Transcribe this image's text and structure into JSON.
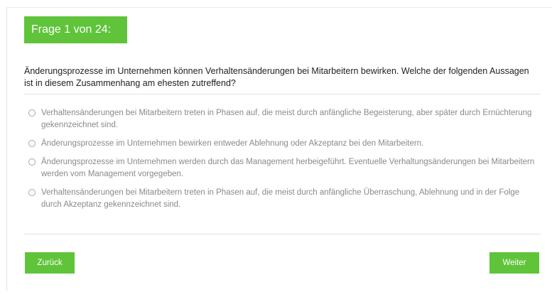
{
  "header": {
    "title": "Frage 1 von 24:"
  },
  "question": {
    "text": "Änderungsprozesse im Unternehmen können Verhaltensänderungen bei Mitarbeitern bewirken. Welche der folgenden Aussagen ist in diesem Zusammenhang am ehesten zutreffend?"
  },
  "options": [
    {
      "label": "Verhaltensänderungen bei Mitarbeitern treten in Phasen auf, die meist durch anfängliche Begeisterung, aber später durch Ernüchterung gekennzeichnet sind.",
      "selected": false
    },
    {
      "label": "Änderungsprozesse im Unternehmen bewirken entweder Ablehnung oder Akzeptanz bei den Mitarbeitern.",
      "selected": false
    },
    {
      "label": "Änderungsprozesse im Unternehmen werden durch das Management herbeigeführt. Eventuelle Verhaltungsänderungen bei Mitarbeitern werden vom Management vorgegeben.",
      "selected": false
    },
    {
      "label": "Verhaltensänderungen bei Mitarbeitern treten in Phasen auf, die meist durch anfängliche Überraschung, Ablehnung und in der Folge durch Akzeptanz gekennzeichnet sind.",
      "selected": false
    }
  ],
  "nav": {
    "back_label": "Zurück",
    "next_label": "Weiter"
  },
  "colors": {
    "accent": "#5fc43a",
    "option_text": "#8a8a8a",
    "question_text": "#1f1f1f"
  }
}
